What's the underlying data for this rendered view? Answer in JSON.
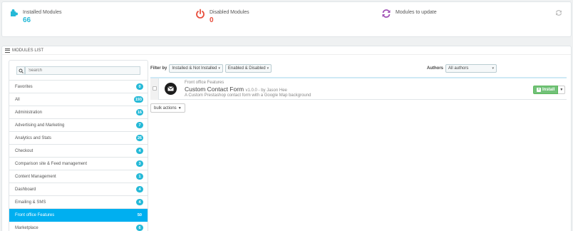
{
  "kpis": [
    {
      "title": "Installed Modules",
      "value": "66",
      "color": "#25b9d7",
      "icon": "puzzle-icon"
    },
    {
      "title": "Disabled Modules",
      "value": "0",
      "color": "#e84e3c",
      "icon": "power-icon"
    },
    {
      "title": "Modules to update",
      "value": "",
      "color": "#a154b6",
      "icon": "sync-icon"
    }
  ],
  "list_heading": "MODULES LIST",
  "search": {
    "placeholder": "Search"
  },
  "categories": [
    {
      "label": "Favorites",
      "count": "0"
    },
    {
      "label": "All",
      "count": "193"
    },
    {
      "label": "Administration",
      "count": "16"
    },
    {
      "label": "Advertising and Marketing",
      "count": "7"
    },
    {
      "label": "Analytics and Stats",
      "count": "26"
    },
    {
      "label": "Checkout",
      "count": "4"
    },
    {
      "label": "Comparison site & Feed management",
      "count": "3"
    },
    {
      "label": "Content Management",
      "count": "1"
    },
    {
      "label": "Dashboard",
      "count": "4"
    },
    {
      "label": "Emailing & SMS",
      "count": "4"
    },
    {
      "label": "Front office Features",
      "count": "50",
      "active": true
    },
    {
      "label": "Marketplace",
      "count": "6"
    }
  ],
  "filter": {
    "label": "Filter by",
    "install_select": "Installed & Not Installed",
    "status_select": "Enabled & Disabled",
    "authors_label": "Authors",
    "authors_select": "All authors"
  },
  "module": {
    "category": "Front office Features",
    "name": "Custom Contact Form",
    "version": "v1.0.0 - by Jason Hee",
    "description": "A Custom Prestashop contact form with a Google Map background",
    "install_label": "Install"
  },
  "bulk_actions_label": "bulk actions"
}
